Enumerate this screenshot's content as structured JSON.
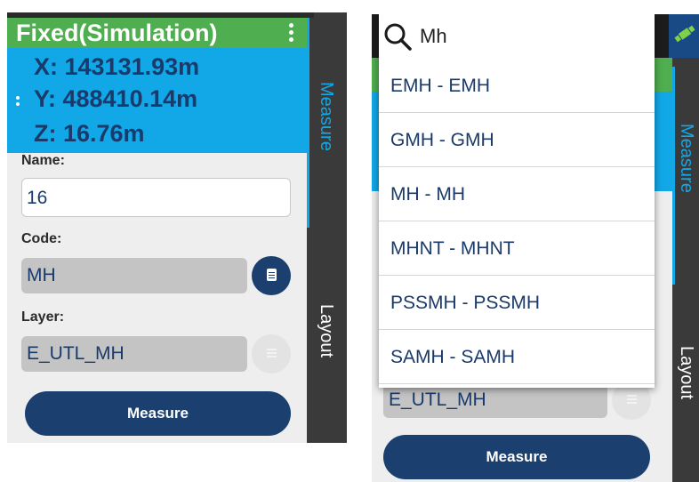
{
  "status": {
    "title": "Fixed(Simulation)"
  },
  "coords": {
    "x": "X: 143131.93m",
    "y": "Y: 488410.14m",
    "z": "Z: 16.76m"
  },
  "form": {
    "name_label": "Name:",
    "name_value": "16",
    "code_label": "Code:",
    "code_value": "MH",
    "layer_label": "Layer:",
    "layer_value": "E_UTL_MH",
    "measure_button": "Measure"
  },
  "tabs": {
    "measure": "Measure",
    "layout": "Layout"
  },
  "dropdown": {
    "search_value": "Mh",
    "options": [
      "EMH - EMH",
      "GMH - GMH",
      "MH - MH",
      "MHNT - MHNT",
      "PSSMH - PSSMH",
      "SAMH - SAMH"
    ]
  },
  "colors": {
    "fix_green": "#4fae4f",
    "coords_blue": "#12a7e6",
    "primary_navy": "#1b3f6e"
  },
  "icons": [
    "more-vert-icon",
    "drag-handle-icon",
    "code-list-icon",
    "layer-list-icon",
    "search-icon",
    "satellite-icon"
  ]
}
